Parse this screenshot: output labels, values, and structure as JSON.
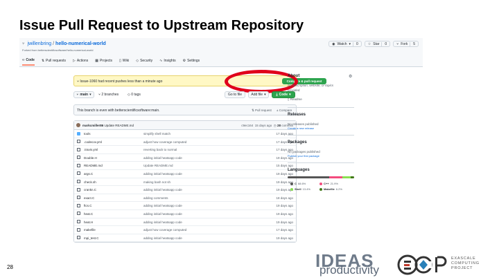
{
  "slide": {
    "title": "Issue Pull Request to Upstream Repository",
    "number": "28"
  },
  "repo": {
    "owner": "jwillenbring",
    "name": "hello-numerical-world",
    "forked_from": "Forked from betterscientificsoftware/hello-numerical-world",
    "buttons": [
      {
        "label": "Watch",
        "count": "0"
      },
      {
        "label": "Star",
        "count": "0"
      },
      {
        "label": "Fork",
        "count": "5"
      }
    ],
    "tabs": [
      "Code",
      "Pull requests",
      "Actions",
      "Projects",
      "Wiki",
      "Security",
      "Insights",
      "Settings"
    ]
  },
  "banner": {
    "text": "Issue-1060 had recent pushes less than a minute ago",
    "compare_label": "Compare & pull request"
  },
  "branchbar": {
    "branch": "main",
    "branches": "2 branches",
    "tags": "0 tags",
    "go_to_file": "Go to file",
    "add_file": "Add file",
    "code": "Code"
  },
  "even": {
    "text": "This branch is even with betterscientificsoftware:main.",
    "pull_request": "Pull request",
    "compare": "Compare"
  },
  "commit": {
    "author": "markcmiller86",
    "message": "Update README.md",
    "hash": "c9ec164",
    "age": "15 days ago",
    "commits": "28",
    "commits_label": "commits"
  },
  "files": [
    {
      "name": "tools",
      "type": "dir",
      "message": "simplify shell match",
      "age": "17 days ago"
    },
    {
      "name": ".codecov.yml",
      "type": "file",
      "message": "adjust how coverage computed",
      "age": "17 days ago"
    },
    {
      "name": ".travis.yml",
      "type": "file",
      "message": "reverting back to normal",
      "age": "17 days ago"
    },
    {
      "name": "Double.H",
      "type": "file",
      "message": "adding initial heatsapp code",
      "age": "19 days ago"
    },
    {
      "name": "README.md",
      "type": "file",
      "message": "Update README.md",
      "age": "15 days ago"
    },
    {
      "name": "args.C",
      "type": "file",
      "message": "adding initial heatsapp code",
      "age": "19 days ago"
    },
    {
      "name": "check.sh",
      "type": "file",
      "message": "making bash not sh",
      "age": "19 days ago"
    },
    {
      "name": "crankn.C",
      "type": "file",
      "message": "adding initial heatsapp code",
      "age": "19 days ago"
    },
    {
      "name": "exact.C",
      "type": "file",
      "message": "adding comments",
      "age": "18 days ago"
    },
    {
      "name": "ftcs.C",
      "type": "file",
      "message": "adding initial heatsapp code",
      "age": "19 days ago"
    },
    {
      "name": "heat.C",
      "type": "file",
      "message": "adding initial heatsapp code",
      "age": "19 days ago"
    },
    {
      "name": "heat.H",
      "type": "file",
      "message": "adding initial heatsapp code",
      "age": "19 days ago"
    },
    {
      "name": "makefile",
      "type": "file",
      "message": "adjust how coverage computed",
      "age": "17 days ago"
    },
    {
      "name": "mpi_test.C",
      "type": "file",
      "message": "adding initial heatsapp code",
      "age": "19 days ago"
    }
  ],
  "sidebar": {
    "about": "About",
    "about_text_1": "No description, website, or topics",
    "about_text_2": "provided.",
    "readme": "Readme",
    "releases": "Releases",
    "no_releases": "No releases published",
    "create_release": "Create a new release",
    "packages": "Packages",
    "no_packages": "No packages published",
    "publish_package": "Publish your first package",
    "languages": "Languages",
    "langs": [
      {
        "name": "C",
        "pct": "68.6%",
        "color": "#555555"
      },
      {
        "name": "C++",
        "pct": "21.9%",
        "color": "#f34b7d"
      },
      {
        "name": "Shell",
        "pct": "13.4%",
        "color": "#89e051"
      },
      {
        "name": "Makefile",
        "pct": "6.2%",
        "color": "#427819"
      }
    ]
  },
  "logos": {
    "ideas": "IDEAS",
    "productivity": "productivity",
    "ecp_line1": "EXASCALE",
    "ecp_line2": "COMPUTING",
    "ecp_line3": "PROJECT"
  },
  "colors": {
    "accent_green": "#2da44e",
    "highlight_red": "#e0001b",
    "link_blue": "#0969da"
  }
}
